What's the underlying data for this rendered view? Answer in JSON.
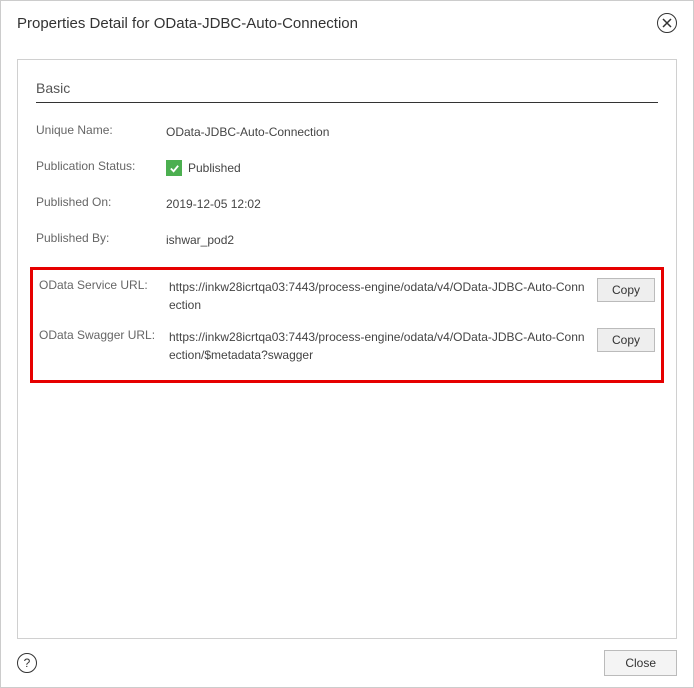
{
  "header": {
    "title": "Properties Detail for OData-JDBC-Auto-Connection"
  },
  "section": {
    "title": "Basic"
  },
  "fields": {
    "unique_name": {
      "label": "Unique Name:",
      "value": "OData-JDBC-Auto-Connection"
    },
    "publication_status": {
      "label": "Publication Status:",
      "value": "Published"
    },
    "published_on": {
      "label": "Published On:",
      "value": "2019-12-05 12:02"
    },
    "published_by": {
      "label": "Published By:",
      "value": "ishwar_pod2"
    },
    "service_url": {
      "label": "OData Service URL:",
      "value": "https://inkw28icrtqa03:7443/process-engine/odata/v4/OData-JDBC-Auto-Connection"
    },
    "swagger_url": {
      "label": "OData Swagger URL:",
      "value": "https://inkw28icrtqa03:7443/process-engine/odata/v4/OData-JDBC-Auto-Connection/$metadata?swagger"
    }
  },
  "buttons": {
    "copy": "Copy",
    "close": "Close"
  },
  "icons": {
    "help": "?"
  }
}
